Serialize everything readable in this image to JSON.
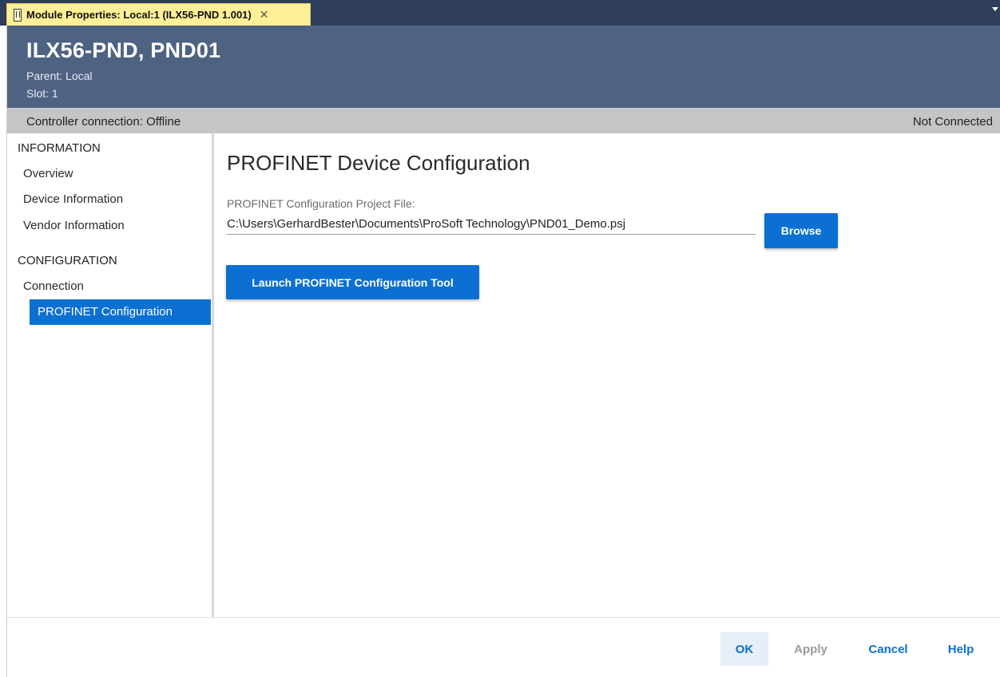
{
  "tab": {
    "title": "Module Properties: Local:1 (ILX56-PND 1.001)",
    "close_glyph": "✕",
    "icon": "module-icon"
  },
  "header": {
    "title": "ILX56-PND, PND01",
    "parent": "Parent: Local",
    "slot": "Slot: 1"
  },
  "status": {
    "controller_connection": "Controller connection: Offline",
    "connection_state": "Not Connected"
  },
  "sidebar": {
    "sections": [
      {
        "label": "INFORMATION",
        "items": [
          "Overview",
          "Device Information",
          "Vendor Information"
        ]
      },
      {
        "label": "CONFIGURATION",
        "items": [
          "Connection",
          "PROFINET Configuration"
        ]
      }
    ],
    "selected": "PROFINET Configuration"
  },
  "main": {
    "title": "PROFINET Device Configuration",
    "file_label": "PROFINET Configuration Project File:",
    "file_path": "C:\\Users\\GerhardBester\\Documents\\ProSoft Technology\\PND01_Demo.psj",
    "browse_label": "Browse",
    "launch_label": "Launch PROFINET Configuration Tool"
  },
  "footer": {
    "ok": "OK",
    "apply": "Apply",
    "cancel": "Cancel",
    "help": "Help"
  },
  "colors": {
    "header_bg": "#4e6282",
    "tabstrip_bg": "#2e3d59",
    "tab_bg": "#ffef97",
    "accent": "#0c70d3",
    "statusbar_bg": "#c5c5c5"
  }
}
